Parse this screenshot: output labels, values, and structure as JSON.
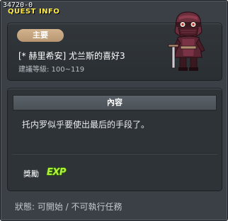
{
  "window": {
    "quest_id": "34720-0",
    "title": "QUEST INFO"
  },
  "quest": {
    "type_badge": "主要",
    "name": "[* 赫里希安] 尤兰斯的喜好3",
    "level_requirement": "建議等級: 100~119",
    "portrait_icon": "masked-hunter-npc-icon"
  },
  "content": {
    "section_title": "內容",
    "description": "托内罗似乎要使出最后的手段了。"
  },
  "reward": {
    "label": "獎勵",
    "exp_icon_text": "EXP"
  },
  "status": {
    "text": "狀態: 可開始 / 不可執行任務"
  },
  "colors": {
    "title": "#ffe94a",
    "badge": "#c8a882",
    "exp": "#b6f03a"
  }
}
